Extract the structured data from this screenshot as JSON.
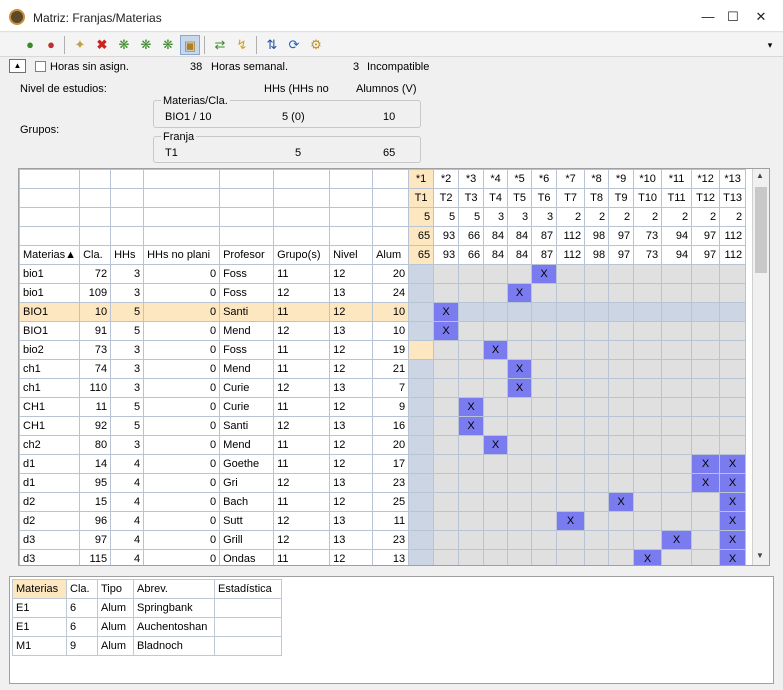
{
  "window": {
    "title": "Matriz: Franjas/Materias"
  },
  "toolbar": {
    "icons": [
      "people-green-icon",
      "people-red-icon",
      "new-icon",
      "delete-icon",
      "cluster-icon",
      "cluster2-icon",
      "cluster3-icon",
      "lock-icon",
      "exchange-icon",
      "lightning-icon",
      "sort-icon",
      "refresh-icon",
      "settings-icon"
    ],
    "dropdown": "▾"
  },
  "filters": {
    "horas_sin_asign": "Horas sin asign.",
    "horas_semanal_value": "38",
    "horas_semanal_label": "Horas semanal.",
    "incompatible_value": "3",
    "incompatible_label": "Incompatible",
    "nivel_label": "Nivel de estudios:",
    "grupos_label": "Grupos:"
  },
  "info_materias": {
    "header": "Materias/Cla.",
    "hhs_header": "HHs (HHs no",
    "alumnos_header": "Alumnos (V)",
    "value": "BIO1 / 10",
    "hhs": "5 (0)",
    "alumnos": "10"
  },
  "info_franja": {
    "header": "Franja",
    "value": "T1",
    "hhs": "5",
    "alumnos": "65"
  },
  "columns": [
    "Materias",
    "Cla.",
    "HHs",
    "HHs no plani",
    "Profesor",
    "Grupo(s)",
    "Nivel",
    "Alum"
  ],
  "sort_indicator": "▲",
  "slots": {
    "stars": [
      "*1",
      "*2",
      "*3",
      "*4",
      "*5",
      "*6",
      "*7",
      "*8",
      "*9",
      "*10",
      "*11",
      "*12",
      "*13"
    ],
    "names": [
      "T1",
      "T2",
      "T3",
      "T4",
      "T5",
      "T6",
      "T7",
      "T8",
      "T9",
      "T10",
      "T11",
      "T12",
      "T13"
    ],
    "hours": [
      "5",
      "5",
      "5",
      "3",
      "3",
      "3",
      "2",
      "2",
      "2",
      "2",
      "2",
      "2",
      "2"
    ],
    "totals": [
      "65",
      "93",
      "66",
      "84",
      "84",
      "87",
      "112",
      "98",
      "97",
      "73",
      "94",
      "97",
      "112"
    ],
    "alum": [
      "65",
      "93",
      "66",
      "84",
      "84",
      "87",
      "112",
      "98",
      "97",
      "73",
      "94",
      "97",
      "112"
    ]
  },
  "rows": [
    {
      "m": "bio1",
      "cla": "72",
      "hhs": "3",
      "hnp": "0",
      "prof": "Foss",
      "grp": "11",
      "niv": "12",
      "alum": "20",
      "x": [
        6
      ]
    },
    {
      "m": "bio1",
      "cla": "109",
      "hhs": "3",
      "hnp": "0",
      "prof": "Foss",
      "grp": "12",
      "niv": "13",
      "alum": "24",
      "x": [
        5
      ]
    },
    {
      "m": "BIO1",
      "cla": "10",
      "hhs": "5",
      "hnp": "0",
      "prof": "Santi",
      "grp": "11",
      "niv": "12",
      "alum": "10",
      "x": [
        2
      ],
      "sel": true
    },
    {
      "m": "BIO1",
      "cla": "91",
      "hhs": "5",
      "hnp": "0",
      "prof": "Mend",
      "grp": "12",
      "niv": "13",
      "alum": "10",
      "x": [
        2
      ]
    },
    {
      "m": "bio2",
      "cla": "73",
      "hhs": "3",
      "hnp": "0",
      "prof": "Foss",
      "grp": "11",
      "niv": "12",
      "alum": "19",
      "x": [
        4
      ],
      "t1": true
    },
    {
      "m": "ch1",
      "cla": "74",
      "hhs": "3",
      "hnp": "0",
      "prof": "Mend",
      "grp": "11",
      "niv": "12",
      "alum": "21",
      "x": [
        5
      ]
    },
    {
      "m": "ch1",
      "cla": "110",
      "hhs": "3",
      "hnp": "0",
      "prof": "Curie",
      "grp": "12",
      "niv": "13",
      "alum": "7",
      "x": [
        5
      ]
    },
    {
      "m": "CH1",
      "cla": "11",
      "hhs": "5",
      "hnp": "0",
      "prof": "Curie",
      "grp": "11",
      "niv": "12",
      "alum": "9",
      "x": [
        3
      ]
    },
    {
      "m": "CH1",
      "cla": "92",
      "hhs": "5",
      "hnp": "0",
      "prof": "Santi",
      "grp": "12",
      "niv": "13",
      "alum": "16",
      "x": [
        3
      ]
    },
    {
      "m": "ch2",
      "cla": "80",
      "hhs": "3",
      "hnp": "0",
      "prof": "Mend",
      "grp": "11",
      "niv": "12",
      "alum": "20",
      "x": [
        4
      ]
    },
    {
      "m": "d1",
      "cla": "14",
      "hhs": "4",
      "hnp": "0",
      "prof": "Goethe",
      "grp": "11",
      "niv": "12",
      "alum": "17",
      "x": [
        12,
        13
      ]
    },
    {
      "m": "d1",
      "cla": "95",
      "hhs": "4",
      "hnp": "0",
      "prof": "Gri",
      "grp": "12",
      "niv": "13",
      "alum": "23",
      "x": [
        12,
        13
      ]
    },
    {
      "m": "d2",
      "cla": "15",
      "hhs": "4",
      "hnp": "0",
      "prof": "Bach",
      "grp": "11",
      "niv": "12",
      "alum": "25",
      "x": [
        9,
        13
      ]
    },
    {
      "m": "d2",
      "cla": "96",
      "hhs": "4",
      "hnp": "0",
      "prof": "Sutt",
      "grp": "12",
      "niv": "13",
      "alum": "11",
      "x": [
        7,
        13
      ]
    },
    {
      "m": "d3",
      "cla": "97",
      "hhs": "4",
      "hnp": "0",
      "prof": "Grill",
      "grp": "12",
      "niv": "13",
      "alum": "23",
      "x": [
        11,
        13
      ]
    },
    {
      "m": "d3",
      "cla": "115",
      "hhs": "4",
      "hnp": "0",
      "prof": "Ondas",
      "grp": "11",
      "niv": "12",
      "alum": "13",
      "x": [
        10,
        13
      ]
    }
  ],
  "mark": "X",
  "bottom": {
    "headers": [
      "Materias",
      "Cla.",
      "Tipo",
      "Abrev.",
      "Estadística"
    ],
    "rows": [
      [
        "E1",
        "6",
        "Alum",
        "Springbank",
        ""
      ],
      [
        "E1",
        "6",
        "Alum",
        "Auchentoshan",
        ""
      ],
      [
        "M1",
        "9",
        "Alum",
        "Bladnoch",
        ""
      ]
    ]
  }
}
